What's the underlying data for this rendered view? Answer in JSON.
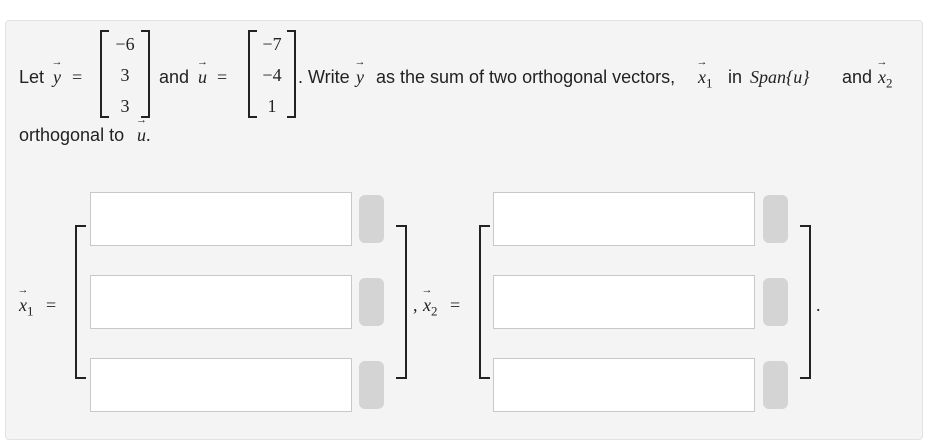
{
  "problem": {
    "let": "Let",
    "y_label": "y",
    "equals": "=",
    "y_vector": [
      "−6",
      "3",
      "3"
    ],
    "and": "and",
    "u_label": "u",
    "u_vector": [
      "−7",
      "−4",
      "1"
    ],
    "write_text": ". Write",
    "mid_text": "as the sum of two orthogonal vectors,",
    "x1_label": "x",
    "x1_sub": "1",
    "in": "in",
    "span_text": "Span",
    "span_arg": "{u}",
    "x2_label": "x",
    "x2_sub": "2",
    "orthogonal_to": "orthogonal to",
    "period": "."
  },
  "answer": {
    "x1_label": "x",
    "x1_sub": "1",
    "x2_label": "x",
    "x2_sub": "2",
    "equals": "=",
    "comma": ",",
    "period": ".",
    "x1_inputs": [
      "",
      "",
      ""
    ],
    "x2_inputs": [
      "",
      "",
      ""
    ]
  }
}
